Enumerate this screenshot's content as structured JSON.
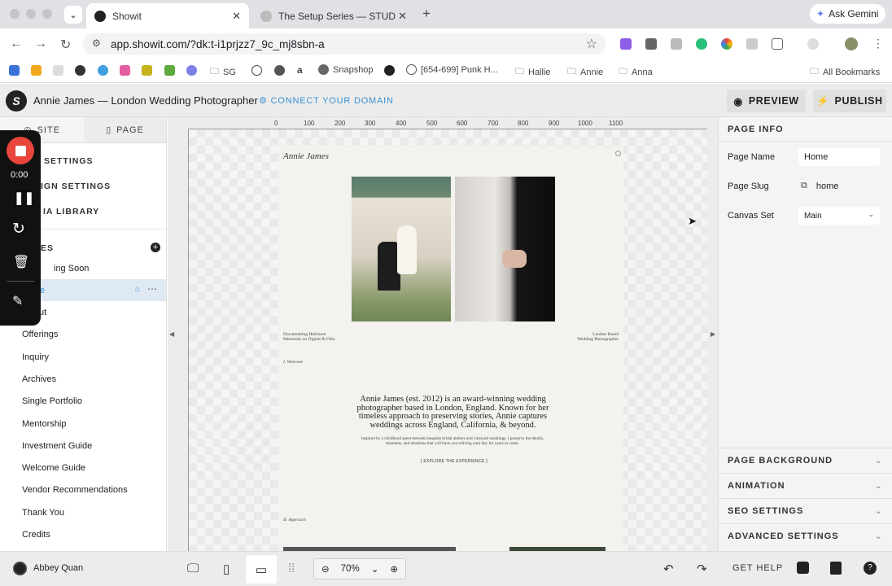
{
  "browser": {
    "tabs": [
      {
        "title": "Showit",
        "active": true
      },
      {
        "title": "The Setup Series — STUDIO",
        "active": false
      }
    ],
    "new_tab": "+",
    "gemini_label": "Ask Gemini",
    "url": "app.showit.com/?dk:t-i1prjzz7_9c_mj8sbn-a",
    "bookmarks": [
      "SG",
      "Snapshop",
      "[654-699] Punk H...",
      "Hallie",
      "Annie",
      "Anna"
    ],
    "all_bookmarks": "All Bookmarks"
  },
  "header": {
    "site_title": "Annie James — London Wedding Photographer",
    "connect_domain": "CONNECT YOUR DOMAIN",
    "preview": "PREVIEW",
    "publish": "PUBLISH"
  },
  "left_panel": {
    "tab_site": "SITE",
    "tab_page": "PAGE",
    "settings": [
      "SETTINGS",
      "IGN SETTINGS",
      "IA LIBRARY"
    ],
    "pages_heading": "ES",
    "pages": [
      "ing Soon",
      "e",
      "ut",
      "Offerings",
      "Inquiry",
      "Archives",
      "Single Portfolio",
      "Mentorship",
      "Investment Guide",
      "Welcome Guide",
      "Vendor Recommendations",
      "Thank You",
      "Credits"
    ],
    "selected_index": 1
  },
  "recorder": {
    "time": "0:00"
  },
  "ruler": [
    "0",
    "100",
    "200",
    "300",
    "400",
    "500",
    "600",
    "700",
    "800",
    "900",
    "1000",
    "1100"
  ],
  "site_preview": {
    "logo": "Annie James",
    "left_caption": [
      "Documenting Heirloom",
      "Memories on Digital & Film"
    ],
    "right_caption": [
      "London Based",
      "Wedding Photographer"
    ],
    "section1": "I. Welcome",
    "headline": "Annie James (est. 2012) is an award-winning wedding photographer based in London, England. Known for her timeless approach to preserving stories, Annie captures weddings across England, California, & beyond.",
    "body": "Inspired by a childhood spent between bespoke bridal ateliers and vineyard weddings, I preserve the details, moments, and emotions that will have you reliving your day for years to come.",
    "cta": "[ EXPLORE THE EXPERIENCE ]",
    "section2": "II. Approach"
  },
  "right_panel": {
    "heading": "PAGE INFO",
    "page_name_label": "Page Name",
    "page_name_value": "Home",
    "page_slug_label": "Page Slug",
    "page_slug_value": "home",
    "canvas_set_label": "Canvas Set",
    "canvas_set_value": "Main",
    "accordions": [
      "PAGE BACKGROUND",
      "ANIMATION",
      "SEO SETTINGS",
      "ADVANCED SETTINGS"
    ]
  },
  "bottom_bar": {
    "user": "Abbey Quan",
    "zoom": "70%",
    "help": "GET HELP"
  }
}
